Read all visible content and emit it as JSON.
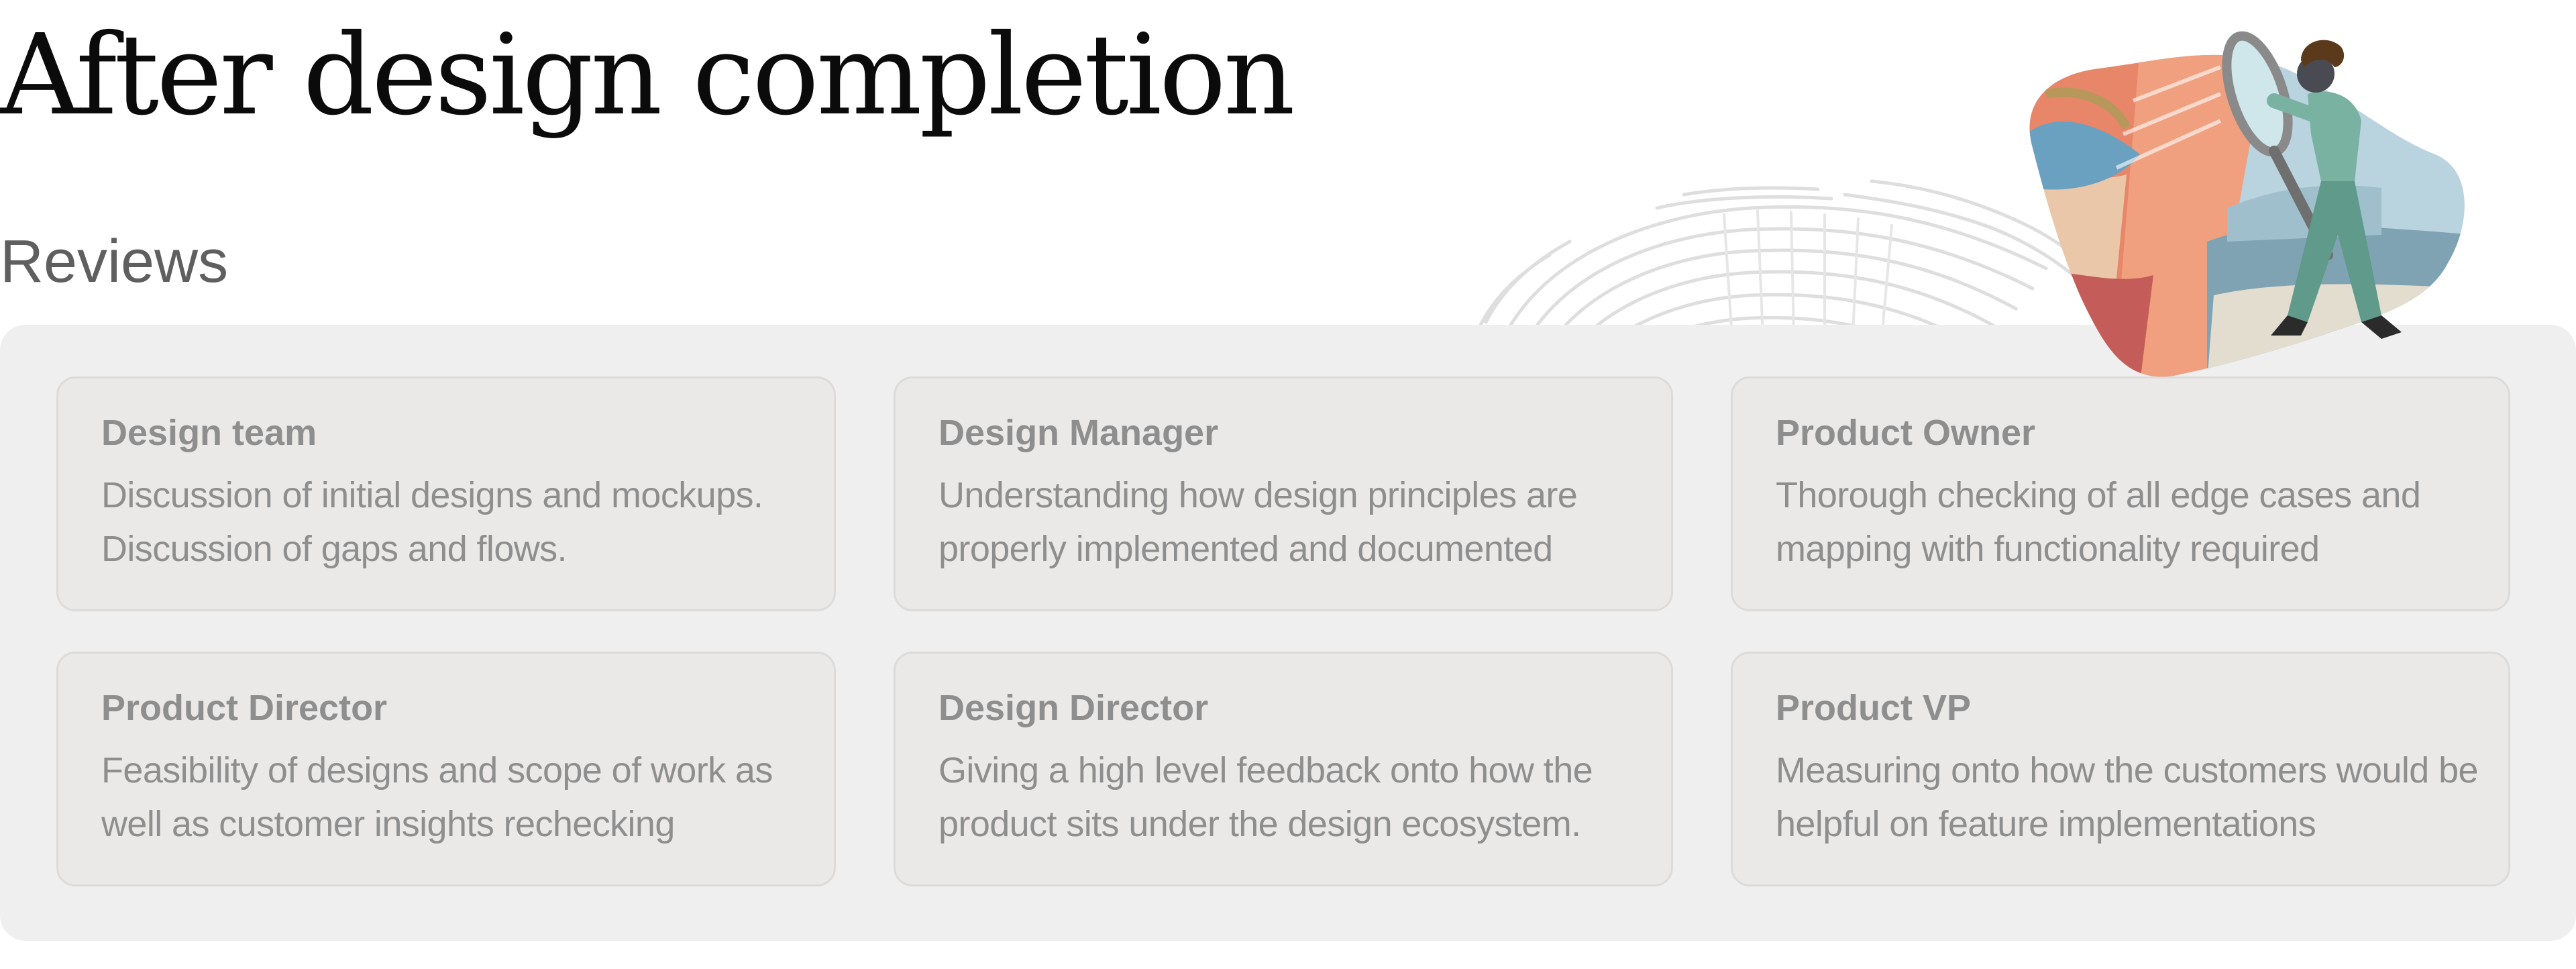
{
  "heading": "After design completion",
  "section_label": "Reviews",
  "reviews": [
    {
      "title": "Design team",
      "description": "Discussion of initial designs and mockups. Discussion of gaps and flows."
    },
    {
      "title": "Design Manager",
      "description": "Understanding how design principles are properly implemented and documented"
    },
    {
      "title": "Product Owner",
      "description": "Thorough checking of all edge cases and mapping with functionality required"
    },
    {
      "title": "Product Director",
      "description": "Feasibility of designs and scope of work as well as customer insights rechecking"
    },
    {
      "title": "Design Director",
      "description": "Giving a high level feedback onto how the product sits under the design ecosystem."
    },
    {
      "title": "Product VP",
      "description": "Measuring onto how the customers would be helpful on feature implementations"
    }
  ],
  "illustration": {
    "icon": "magnifying-glass-person-illustration",
    "colors": {
      "coral": "#e8866a",
      "sky": "#b9d3df",
      "teal": "#5f9a8a",
      "hair": "#5b3a1c",
      "lens_rim": "#8a8a8a"
    }
  },
  "decor": {
    "icon": "fingerprint-pattern",
    "color": "#dedede"
  }
}
